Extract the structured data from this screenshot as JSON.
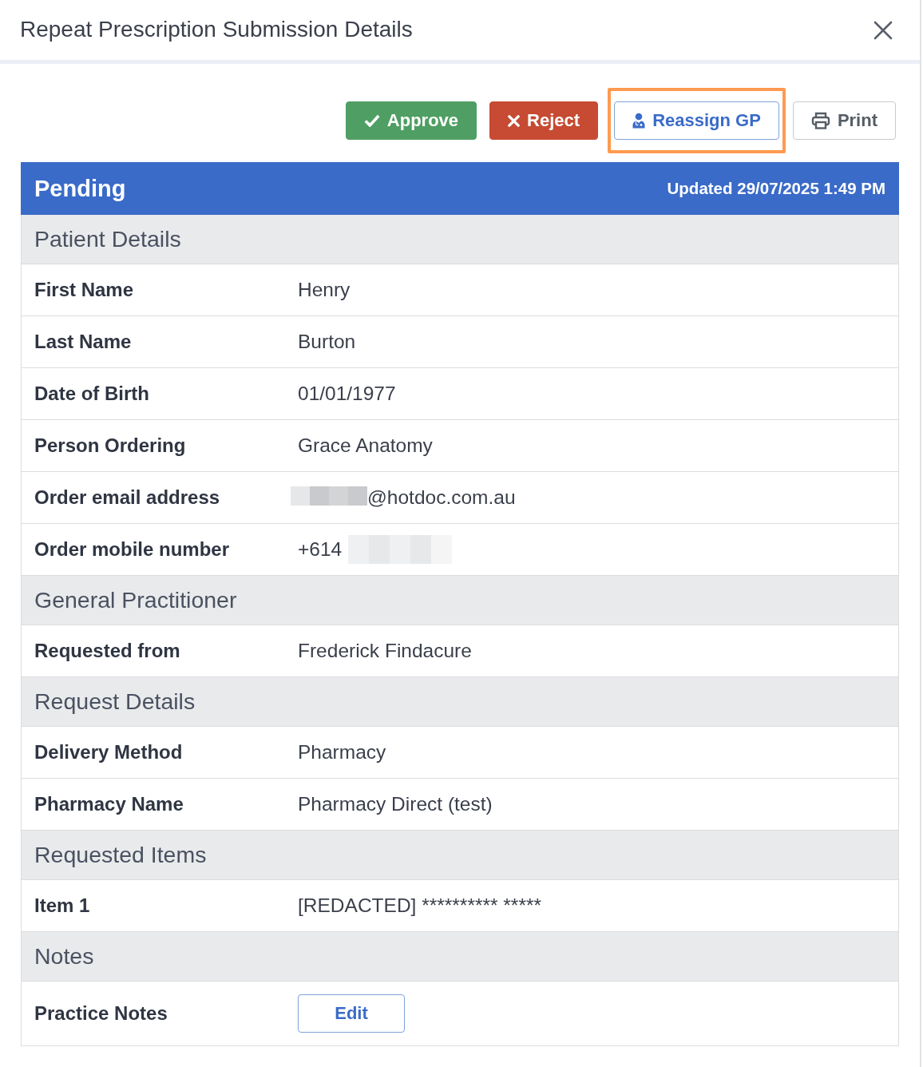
{
  "dialog": {
    "title": "Repeat Prescription Submission Details"
  },
  "actions": [
    {
      "label": "Approve",
      "kind": "approve",
      "highlighted": false
    },
    {
      "label": "Reject",
      "kind": "reject",
      "highlighted": false
    },
    {
      "label": "Reassign GP",
      "kind": "reassign",
      "highlighted": true
    },
    {
      "label": "Print",
      "kind": "print",
      "highlighted": false
    }
  ],
  "status": {
    "label": "Pending",
    "updated": "Updated 29/07/2025 1:49 PM"
  },
  "sections": [
    {
      "title": "Patient Details",
      "rows": [
        {
          "kind": "text",
          "label": "First Name",
          "value": "Henry"
        },
        {
          "kind": "text",
          "label": "Last Name",
          "value": "Burton"
        },
        {
          "kind": "text",
          "label": "Date of Birth",
          "value": "01/01/1977"
        },
        {
          "kind": "text",
          "label": "Person Ordering",
          "value": "Grace Anatomy"
        },
        {
          "kind": "masked_prefix",
          "label": "Order email address",
          "value": "@hotdoc.com.au"
        },
        {
          "kind": "masked_suffix",
          "label": "Order mobile number",
          "value": "+614"
        }
      ]
    },
    {
      "title": "General Practitioner",
      "rows": [
        {
          "kind": "text",
          "label": "Requested from",
          "value": "Frederick Findacure"
        }
      ]
    },
    {
      "title": "Request Details",
      "rows": [
        {
          "kind": "text",
          "label": "Delivery Method",
          "value": "Pharmacy"
        },
        {
          "kind": "text",
          "label": "Pharmacy Name",
          "value": "Pharmacy Direct (test)"
        }
      ]
    },
    {
      "title": "Requested Items",
      "rows": [
        {
          "kind": "text",
          "label": "Item 1",
          "value": "[REDACTED] ********** *****"
        }
      ]
    },
    {
      "title": "Notes",
      "rows": [
        {
          "kind": "button",
          "label": "Practice Notes",
          "value": "Edit"
        }
      ]
    }
  ]
}
